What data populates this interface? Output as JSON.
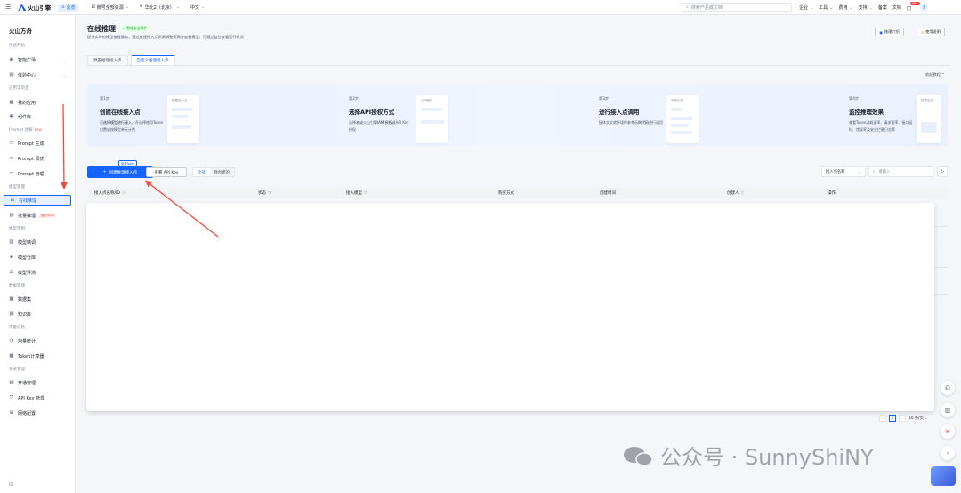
{
  "topbar": {
    "brand": "火山引擎",
    "home": "总览",
    "account_scope": "账号全部资源",
    "region": "华北2（北京）",
    "language": "中文",
    "search_placeholder": "搜索产品或文档",
    "enterprise": "企业",
    "tools": "工具",
    "billing": "费用",
    "support": "支持",
    "filing": "备案",
    "docs": "文档",
    "notify_count": "99+",
    "avatar": "8"
  },
  "sidebar": {
    "title": "火山方舟",
    "groups": {
      "quick": "快速开始",
      "app_lab": "应用实验室",
      "prompt": "Prompt 优解",
      "prompt_tag": "NEW",
      "model_mgmt": "模型管理",
      "model_custom": "模型定制",
      "data_mgmt": "数据管理",
      "usage": "用量信息",
      "system": "系统管理"
    },
    "items": {
      "smart_square": "智能广场",
      "experience": "体验中心",
      "my_apps": "我的应用",
      "components": "组件库",
      "prompt_gen": "Prompt 生成",
      "prompt_opt": "Prompt 调优",
      "prompt_mgmt": "Prompt 管理",
      "online_infer": "在线推理",
      "batch_infer": "批量推理",
      "batch_tag": "限价50%",
      "model_finetune": "模型精调",
      "model_repo": "模型仓库",
      "model_eval": "模型评测",
      "dataset": "数据集",
      "knowledge": "知识库",
      "usage_stats": "用量统计",
      "token_calc": "Token计算器",
      "open_mgmt": "开通管理",
      "apikey_mgmt": "API Key 管理",
      "network": "网络配置"
    }
  },
  "main": {
    "title": "在线推理",
    "protect_badge": "✓ 数据安全保护",
    "subtitle": "提供实时的模型推理服务，通过推理接入点资源调整资源并查看模型，可通过监控查看运行状况",
    "btn_intro": "推理介绍",
    "btn_guide": "使用说明",
    "tabs": [
      "预置推理接入点",
      "自定义推理接入点"
    ],
    "collapse_label": "收起教程",
    "steps": [
      {
        "n": "第1步",
        "title": "创建在线接入点",
        "desc_pre": "可",
        "desc_link": "选择模型进行接入",
        "desc_post": "。开选择使用Token付费或按模型单元计费",
        "card": "配置接入点"
      },
      {
        "n": "第2步",
        "title": "选择API授权方式",
        "desc_pre": "选择者或火山引擎",
        "desc_link": "IAM 授权",
        "desc_post": "或API Key 授权",
        "card": "API授权"
      },
      {
        "n": "第3步",
        "title": "进行接入点调用",
        "desc_pre": "接体交交就环境你参考",
        "desc_link": "示例代码",
        "desc_post": "进行调用",
        "card": "调用示例"
      },
      {
        "n": "第4步",
        "title": "监控推理效果",
        "desc_pre": "",
        "desc_link": "",
        "desc_post": "查看Token消耗速率、请求速率、接口延时、错误率及安全拦截日志等",
        "card": "效果监控"
      }
    ],
    "btn_create": "创建推理接入点",
    "free_tag": "免费Token",
    "btn_apikey": "查看 API Key",
    "seg": [
      "全部",
      "我创建的"
    ],
    "filter_select": "接入点名称",
    "filter_placeholder": "请输入",
    "columns": {
      "name": "接入点名称/ID",
      "status": "状态",
      "model": "接入模型",
      "purchase": "购买方式",
      "created_time": "创建时间",
      "creator": "创建人",
      "ops": "操作"
    },
    "pager": {
      "current": "1",
      "page_size": "10 条/页"
    }
  },
  "watermark": "公众号 · SunnyShiNY"
}
